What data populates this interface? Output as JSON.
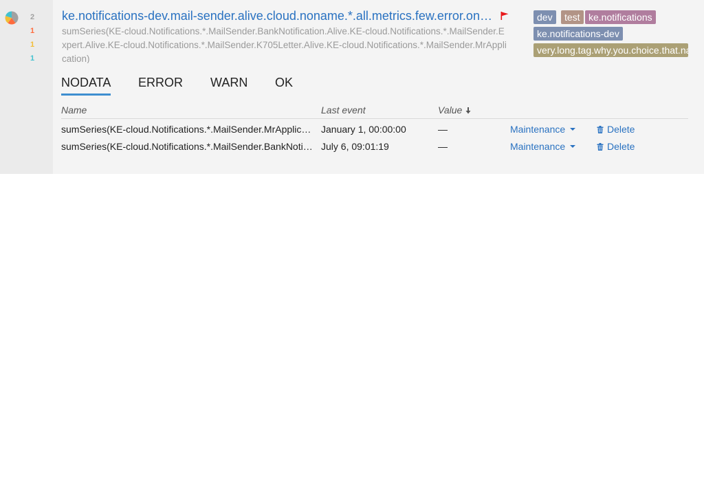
{
  "colors": {
    "link": "#2a72c1",
    "nodata": "#a1a1a1",
    "error": "#ff6b3d",
    "warn": "#f3bd36",
    "ok": "#41c1cf",
    "flag": "#e8191b",
    "tab_active": "#3e8ed0"
  },
  "summary": {
    "pie": [
      {
        "state": "NODATA",
        "count": 2,
        "color": "#a1a1a1"
      },
      {
        "state": "ERROR",
        "count": 1,
        "color": "#ff6b3d"
      },
      {
        "state": "WARN",
        "count": 1,
        "color": "#f3bd36"
      },
      {
        "state": "OK",
        "count": 1,
        "color": "#41c1cf"
      }
    ],
    "counts": [
      "2",
      "1",
      "1",
      "1"
    ]
  },
  "trigger": {
    "title": "ke.notifications-dev.mail-sender.alive.cloud.noname.*.all.metrics.few.error.on…",
    "flag_icon": "flag-icon",
    "target": "sumSeries(KE-cloud.Notifications.*.MailSender.BankNotification.Alive.KE-cloud.Notifications.*.MailSender.Expert.Alive.KE-cloud.Notifications.*.MailSender.K705Letter.Alive.KE-cloud.Notifications.*.MailSender.MrApplication)",
    "tags": [
      {
        "label": "dev",
        "color": "#7d8fb0"
      },
      {
        "label": "test",
        "color": "#b29486"
      },
      {
        "label": "ke.notifications",
        "color": "#b07d9e"
      },
      {
        "label": "ke.notifications-dev",
        "color": "#7d8fb0"
      },
      {
        "label": "very.long.tag.why.you.choice.that.na",
        "color": "#aba075"
      }
    ]
  },
  "tabs": [
    "NODATA",
    "ERROR",
    "WARN",
    "OK"
  ],
  "active_tab": "NODATA",
  "table": {
    "headers": {
      "name": "Name",
      "last_event": "Last event",
      "value": "Value"
    },
    "sort_icon": "sort-desc-icon",
    "rows": [
      {
        "name": "sumSeries(KE-cloud.Notifications.*.MailSender.MrApplic…",
        "last_event": "January 1, 00:00:00",
        "value": "—",
        "maintenance": "Maintenance",
        "delete": "Delete"
      },
      {
        "name": "sumSeries(KE-cloud.Notifications.*.MailSender.BankNoti…",
        "last_event": "July 6, 09:01:19",
        "value": "—",
        "maintenance": "Maintenance",
        "delete": "Delete"
      }
    ]
  }
}
